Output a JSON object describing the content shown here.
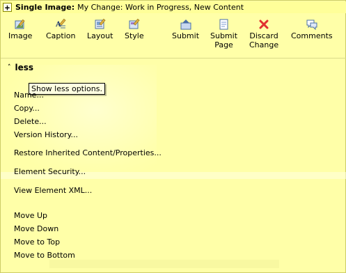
{
  "titlebar": {
    "expand_glyph": "+",
    "label": "Single Image:",
    "status": "My Change: Work in Progress, New Content"
  },
  "toolbar": [
    {
      "label": "Image",
      "icon": "image-edit-icon"
    },
    {
      "label": "Caption",
      "icon": "caption-edit-icon"
    },
    {
      "label": "Layout",
      "icon": "layout-icon"
    },
    {
      "label": "Style",
      "icon": "style-icon"
    },
    {
      "label": "Submit",
      "icon": "submit-icon"
    },
    {
      "label": "Submit Page",
      "line1": "Submit",
      "line2": "Page",
      "icon": "submit-page-icon"
    },
    {
      "label": "Discard Change",
      "line1": "Discard",
      "line2": "Change",
      "icon": "discard-icon"
    },
    {
      "label": "Comments",
      "icon": "comments-icon"
    }
  ],
  "less_toggle": {
    "glyph": "˄",
    "label": "less"
  },
  "tooltip": "Show less options.",
  "menu": {
    "name": "Name...",
    "copy": "Copy...",
    "delete": "Delete...",
    "version_history": "Version History...",
    "restore": "Restore Inherited Content/Properties...",
    "element_security": "Element Security...",
    "view_xml": "View Element XML...",
    "move_up": "Move Up",
    "move_down": "Move Down",
    "move_top": "Move to Top",
    "move_bottom": "Move to Bottom"
  },
  "colors": {
    "background": "#ffffa8",
    "discard_x": "#e03030",
    "tooltip_bg": "#ffffe1"
  }
}
